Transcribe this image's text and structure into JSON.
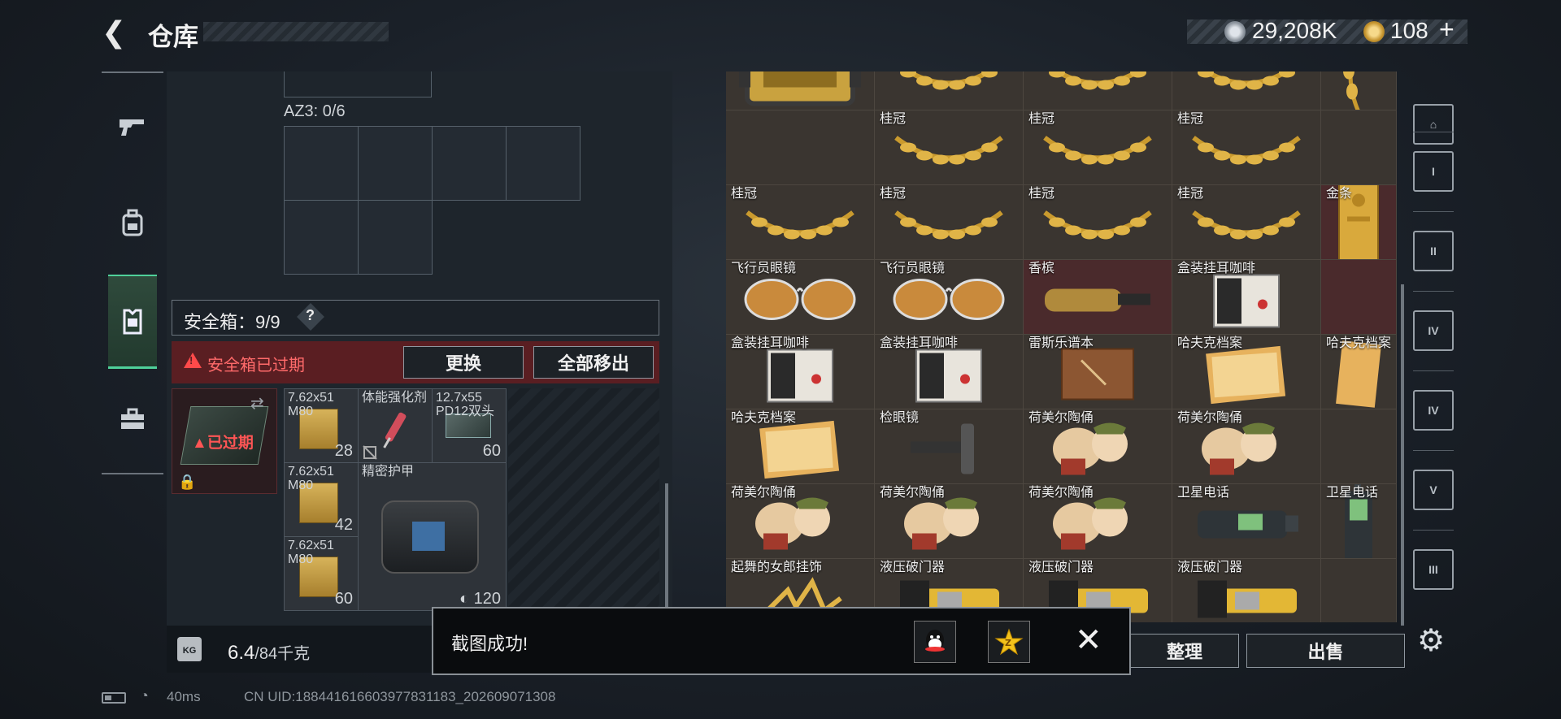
{
  "header": {
    "title": "仓库",
    "currency_silver": "29,208K",
    "currency_gold": "108",
    "currency_add": "+"
  },
  "left_nav": {
    "items": [
      {
        "icon": "pistol-icon",
        "glyph": "🔫"
      },
      {
        "icon": "backpack-icon",
        "glyph": "🎒"
      },
      {
        "icon": "vest-icon",
        "glyph": "🦺"
      },
      {
        "icon": "toolbox-icon",
        "glyph": "🧰"
      }
    ],
    "active_index": 2
  },
  "loadout": {
    "az3_label": "AZ3: 0/6",
    "safe_label": "安全箱：9/9",
    "safe_help": "?",
    "expired_text": "安全箱已过期",
    "replace_button": "更换",
    "remove_all_button": "全部移出",
    "case_expired": "已过期",
    "items": [
      {
        "name": "7.62x51\nM80",
        "count": "28"
      },
      {
        "name": "体能强化剂",
        "count": ""
      },
      {
        "name": "12.7x55\nPD12双头",
        "count": "60"
      },
      {
        "name": "7.62x51\nM80",
        "count": "42"
      },
      {
        "name": "精密护甲",
        "count": "120"
      },
      {
        "name": "7.62x51\nM80",
        "count": "60"
      }
    ],
    "weight_value": "6.4",
    "weight_max": "/84千克",
    "weight_icon": "KG"
  },
  "storage": {
    "rows": [
      [
        {
          "name": "",
          "icon": "case",
          "red": false
        },
        {
          "name": "",
          "icon": "laurel",
          "red": false
        },
        {
          "name": "",
          "icon": "laurel",
          "red": false
        },
        {
          "name": "",
          "icon": "laurel",
          "red": false
        },
        {
          "name": "",
          "icon": "laurel-v",
          "red": false
        }
      ],
      [
        {
          "name": "",
          "icon": "none",
          "red": false
        },
        {
          "name": "桂冠",
          "icon": "laurel",
          "red": false
        },
        {
          "name": "桂冠",
          "icon": "laurel",
          "red": false
        },
        {
          "name": "桂冠",
          "icon": "laurel",
          "red": false
        },
        {
          "name": "",
          "icon": "none",
          "red": false
        }
      ],
      [
        {
          "name": "桂冠",
          "icon": "laurel",
          "red": false
        },
        {
          "name": "桂冠",
          "icon": "laurel",
          "red": false
        },
        {
          "name": "桂冠",
          "icon": "laurel",
          "red": false
        },
        {
          "name": "桂冠",
          "icon": "laurel",
          "red": false
        },
        {
          "name": "金条",
          "icon": "goldbar",
          "red": true
        }
      ],
      [
        {
          "name": "飞行员眼镜",
          "icon": "glasses",
          "red": false
        },
        {
          "name": "飞行员眼镜",
          "icon": "glasses",
          "red": false
        },
        {
          "name": "香槟",
          "icon": "champagne",
          "red": true
        },
        {
          "name": "盒装挂耳咖啡",
          "icon": "coffee",
          "red": false
        },
        {
          "name": "",
          "icon": "none",
          "red": true
        }
      ],
      [
        {
          "name": "盒装挂耳咖啡",
          "icon": "coffee",
          "red": false
        },
        {
          "name": "盒装挂耳咖啡",
          "icon": "coffee",
          "red": false
        },
        {
          "name": "雷斯乐谱本",
          "icon": "book",
          "red": false
        },
        {
          "name": "哈夫克档案",
          "icon": "folder",
          "red": false
        },
        {
          "name": "哈夫克档案",
          "icon": "folder-v",
          "red": false
        }
      ],
      [
        {
          "name": "哈夫克档案",
          "icon": "folder",
          "red": false
        },
        {
          "name": "检眼镜",
          "icon": "scope",
          "red": false
        },
        {
          "name": "荷美尔陶俑",
          "icon": "figurine",
          "red": false
        },
        {
          "name": "荷美尔陶俑",
          "icon": "figurine",
          "red": false
        },
        {
          "name": "",
          "icon": "none",
          "red": false
        }
      ],
      [
        {
          "name": "荷美尔陶俑",
          "icon": "figurine",
          "red": false
        },
        {
          "name": "荷美尔陶俑",
          "icon": "figurine",
          "red": false
        },
        {
          "name": "荷美尔陶俑",
          "icon": "figurine",
          "red": false
        },
        {
          "name": "卫星电话",
          "icon": "satphone",
          "red": false
        },
        {
          "name": "卫星电话",
          "icon": "satphone-v",
          "red": false
        }
      ],
      [
        {
          "name": "起舞的女郎挂饰",
          "icon": "dancer",
          "red": false
        },
        {
          "name": "液压破门器",
          "icon": "breacher",
          "red": false
        },
        {
          "name": "液压破门器",
          "icon": "breacher",
          "red": false
        },
        {
          "name": "液压破门器",
          "icon": "breacher",
          "red": false
        },
        {
          "name": "",
          "icon": "none",
          "red": false
        }
      ]
    ],
    "sort_button": "整理",
    "sell_button": "出售"
  },
  "right_tabs": [
    {
      "label": "⌂",
      "icon": "home-tab-icon"
    },
    {
      "label": "I",
      "icon": "tier-1-tab-icon"
    },
    {
      "label": "II",
      "icon": "tier-2-tab-icon"
    },
    {
      "label": "IV",
      "icon": "tier-4-tab-icon"
    },
    {
      "label": "IV",
      "icon": "tier-4b-tab-icon"
    },
    {
      "label": "V",
      "icon": "tier-5-tab-icon"
    },
    {
      "label": "III",
      "icon": "tier-3-tab-icon"
    }
  ],
  "toast": {
    "message": "截图成功!",
    "share1": "QQ",
    "share2": "Z"
  },
  "status": {
    "ping": "40ms",
    "uid": "CN UID:18844161660397783118​3_202609071308"
  }
}
